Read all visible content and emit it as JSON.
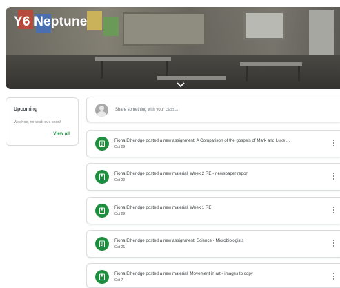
{
  "class": {
    "name": "Y6 Neptune"
  },
  "upcoming": {
    "heading": "Upcoming",
    "empty_text": "Woohoo, no work due soon!",
    "view_all": "View all"
  },
  "composer": {
    "placeholder": "Share something with your class..."
  },
  "stream": [
    {
      "title": "Fiona Etheridge posted a new assignment: A Comparison of the gospels of Mark and Luke ...",
      "date": "Oct 29",
      "icon": "assignment-icon"
    },
    {
      "title": "Fiona Etheridge posted a new material: Week 2 RE - newspaper report",
      "date": "Oct 29",
      "icon": "material-icon"
    },
    {
      "title": "Fiona Etheridge posted a new material: Week 1 RE",
      "date": "Oct 29",
      "icon": "material-icon"
    },
    {
      "title": "Fiona Etheridge posted a new assignment: Science - Microbiologists",
      "date": "Oct 21",
      "icon": "assignment-icon"
    },
    {
      "title": "Fiona Etheridge posted a new material: Movement in art - images to copy",
      "date": "Oct 7",
      "icon": "material-icon"
    }
  ],
  "colors": {
    "accent": "#1e8e3e",
    "text": "#3c4043",
    "muted": "#5f6368",
    "border": "#dadce0"
  }
}
